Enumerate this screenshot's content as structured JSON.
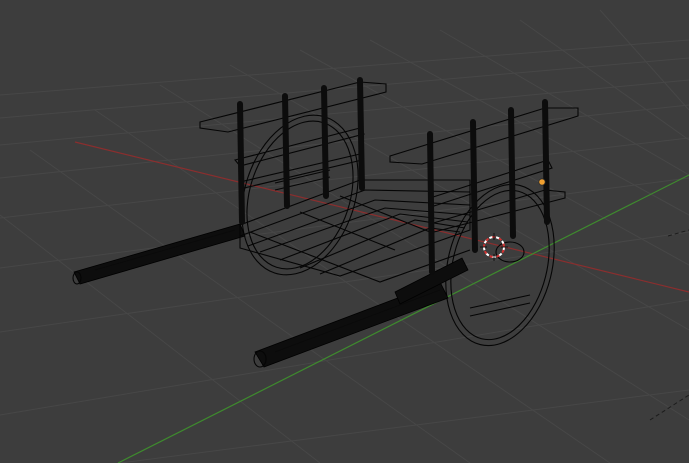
{
  "viewport": {
    "background": "#3d3d3d",
    "grid_color": "#474747",
    "x_axis_color": "#8a2e2e",
    "y_axis_color": "#3e8a2e",
    "wire_color": "#050505",
    "origin_color": "#f0a030",
    "cursor_color_primary": "#ffffff",
    "cursor_color_secondary": "#d03030"
  },
  "scene": {
    "object": "cart",
    "display_mode": "wireframe",
    "icons": {
      "cursor": "3d-cursor-icon",
      "origin": "object-origin-icon"
    }
  }
}
